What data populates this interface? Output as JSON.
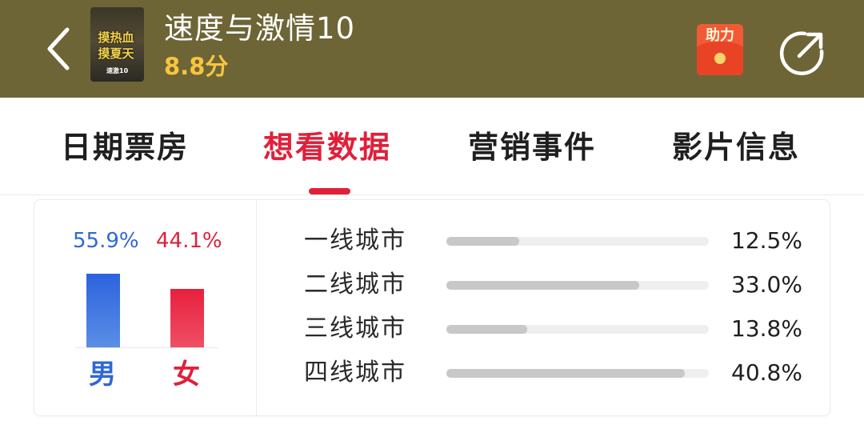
{
  "header": {
    "back_icon": "chevron-left-icon",
    "poster_lines": [
      "摸热血",
      "摸夏天"
    ],
    "poster_tag": "速激10",
    "movie_title": "速度与激情10",
    "score": "8.8分",
    "help_label": "助力",
    "share_icon": "share-arrow-icon",
    "bg_color": "#6d6536",
    "score_color": "#f7c541"
  },
  "tabs": [
    {
      "label": "日期票房",
      "active": false
    },
    {
      "label": "想看数据",
      "active": true
    },
    {
      "label": "营销事件",
      "active": false
    },
    {
      "label": "影片信息",
      "active": false
    }
  ],
  "gender": {
    "male": {
      "percent_text": "55.9%",
      "value": 55.9,
      "label": "男",
      "color": "#2f67d6"
    },
    "female": {
      "percent_text": "44.1%",
      "value": 44.1,
      "label": "女",
      "color": "#e0203a"
    }
  },
  "cities": [
    {
      "label": "一线城市",
      "percent_text": "12.5%",
      "value": 12.5
    },
    {
      "label": "二线城市",
      "percent_text": "33.0%",
      "value": 33.0
    },
    {
      "label": "三线城市",
      "percent_text": "13.8%",
      "value": 13.8
    },
    {
      "label": "四线城市",
      "percent_text": "40.8%",
      "value": 40.8
    }
  ],
  "accent_color": "#e0203a"
}
